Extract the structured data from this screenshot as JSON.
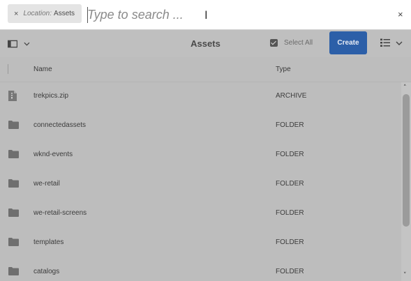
{
  "search": {
    "chip_close": "×",
    "chip_label": "Location:",
    "chip_value": "Assets",
    "placeholder": "Type to search ...",
    "close": "×"
  },
  "toolbar": {
    "title": "Assets",
    "select_all_label": "Select All",
    "create_label": "Create"
  },
  "list": {
    "columns": {
      "name": "Name",
      "type": "Type"
    },
    "rows": [
      {
        "name": "trekpics.zip",
        "type": "ARCHIVE",
        "icon": "zip-file-icon"
      },
      {
        "name": "connectedassets",
        "type": "FOLDER",
        "icon": "folder-icon"
      },
      {
        "name": "wknd-events",
        "type": "FOLDER",
        "icon": "folder-icon"
      },
      {
        "name": "we-retail",
        "type": "FOLDER",
        "icon": "folder-icon"
      },
      {
        "name": "we-retail-screens",
        "type": "FOLDER",
        "icon": "folder-icon"
      },
      {
        "name": "templates",
        "type": "FOLDER",
        "icon": "folder-icon"
      },
      {
        "name": "catalogs",
        "type": "FOLDER",
        "icon": "folder-icon"
      }
    ]
  },
  "colors": {
    "overlay": "#bdbdbd",
    "create_button": "#2c5fa8"
  }
}
